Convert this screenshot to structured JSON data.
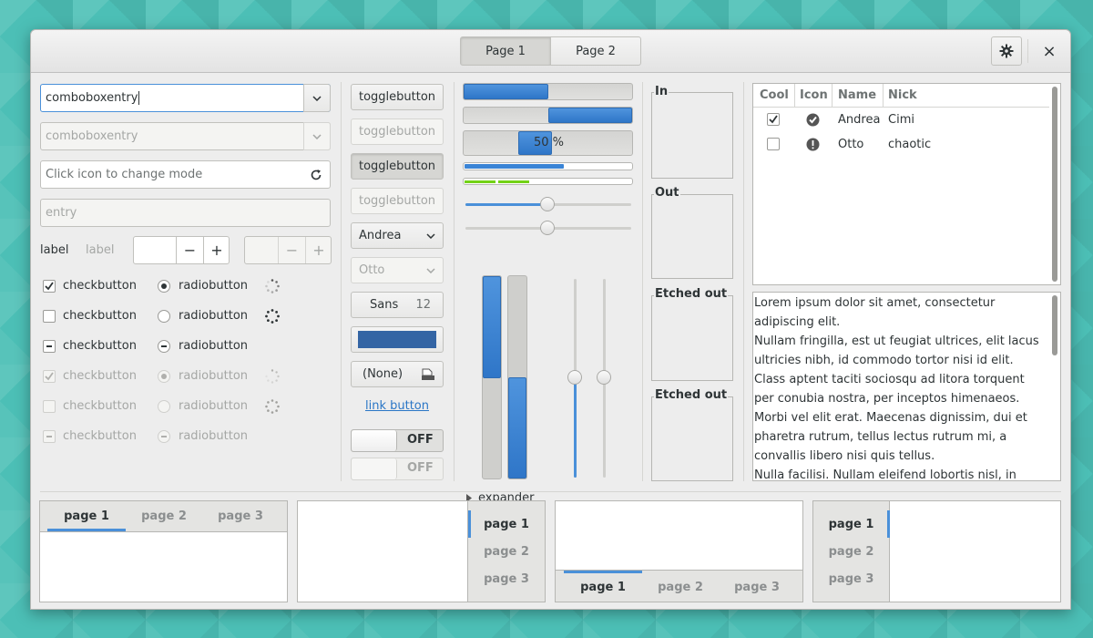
{
  "header": {
    "stack_tabs": [
      "Page 1",
      "Page 2"
    ],
    "close_glyph": "×"
  },
  "left": {
    "combo1_value": "comboboxentry",
    "combo2_value": "comboboxentry",
    "icon_entry_placeholder": "Click icon to change mode",
    "entry_placeholder": "entry",
    "label_active": "label",
    "label_insensitive": "label",
    "spin_minus": "−",
    "spin_plus": "+",
    "checkbutton": "checkbutton",
    "radiobutton": "radiobutton"
  },
  "col2": {
    "toggle": "togglebutton",
    "combo_active": "Andrea",
    "combo_insensitive": "Otto",
    "font_name": "Sans",
    "font_size": "12",
    "color_value": "#3465a4",
    "file_none": "(None)",
    "link": "link button",
    "switch_off": "OFF"
  },
  "col3": {
    "progress_text": "50 %",
    "progress_pct": 50,
    "expander": "expander"
  },
  "frames": {
    "in": "In",
    "out": "Out",
    "etched1": "Etched out",
    "etched2": "Etched out"
  },
  "tree": {
    "headers": [
      "Cool",
      "Icon",
      "Name",
      "Nick"
    ],
    "rows": [
      {
        "name": "Andrea",
        "nick": "Cimi",
        "cool": true,
        "icon": "check-circle-icon"
      },
      {
        "name": "Otto",
        "nick": "chaotic",
        "cool": false,
        "icon": "warning-circle-icon"
      }
    ]
  },
  "textview": {
    "lines": [
      "Lorem ipsum dolor sit amet, consectetur",
      "adipiscing elit.",
      "Nullam fringilla, est ut feugiat ultrices, elit lacus",
      "ultricies nibh, id commodo tortor nisi id elit.",
      "Class aptent taciti sociosqu ad litora torquent",
      "per conubia nostra, per inceptos himenaeos.",
      "Morbi vel elit erat. Maecenas dignissim, dui et",
      "pharetra rutrum, tellus lectus rutrum mi, a",
      "convallis libero nisi quis tellus.",
      "Nulla facilisi. Nullam eleifend lobortis nisl, in"
    ]
  },
  "notebooks": {
    "tabs": [
      "page 1",
      "page 2",
      "page 3"
    ]
  }
}
